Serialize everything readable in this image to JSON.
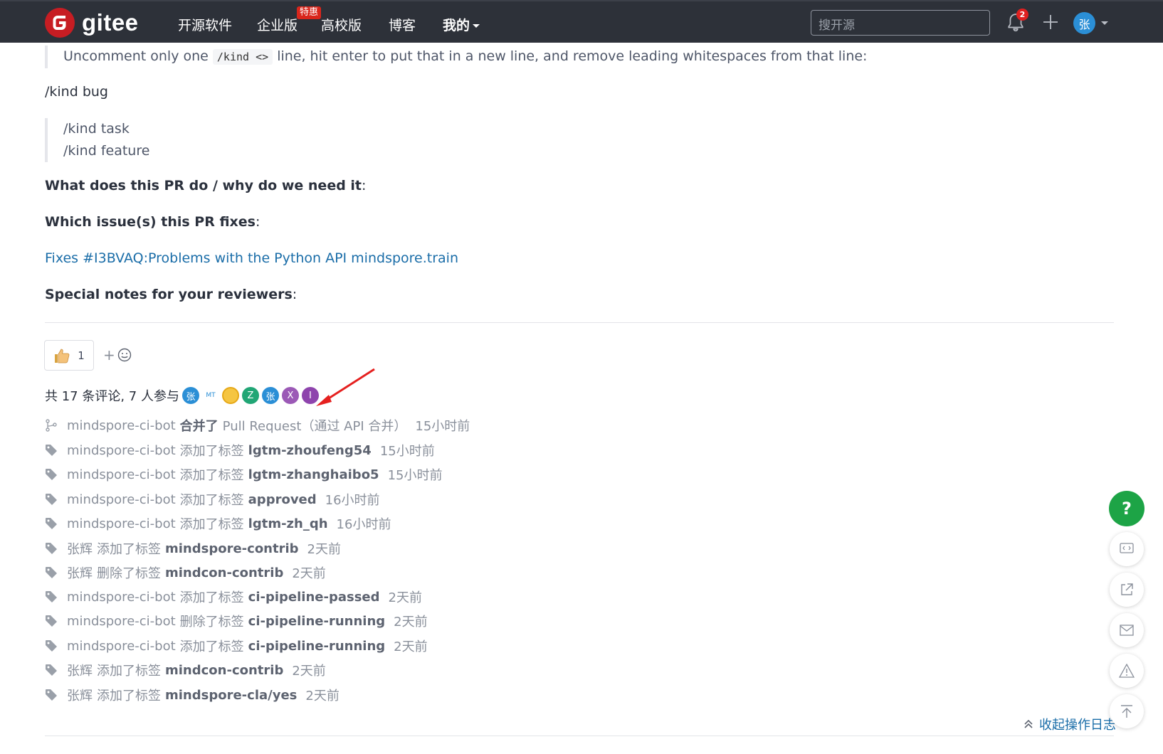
{
  "nav": {
    "brand": "gitee",
    "items": [
      "开源软件",
      "企业版",
      "高校版",
      "博客",
      "我的"
    ],
    "enterprise_badge": "特惠",
    "search_placeholder": "搜开源",
    "notification_count": "2",
    "avatar_initial": "张"
  },
  "description": {
    "instruction_pre": "Uncomment only one",
    "instruction_code": "/kind <>",
    "instruction_post": "line, hit enter to put that in a new line, and remove leading whitespaces from that line:",
    "kind_bug": "/kind bug",
    "kind_task": "/kind task",
    "kind_feature": "/kind feature",
    "what_heading": "What does this PR do / why do we need it",
    "which_heading": "Which issue(s) this PR fixes",
    "fixes_prefix": "Fixes",
    "fixes_link": "#I3BVAQ:Problems with the Python API mindspore.train",
    "notes_heading": "Special notes for your reviewers"
  },
  "reactions": {
    "thumbs_up_count": "1",
    "add_label": "+"
  },
  "participants": {
    "summary": "共 17 条评论, 7 人参与",
    "avatars": [
      {
        "text": "张",
        "color": "#2b8fd6"
      },
      {
        "text": "MT",
        "color": "#ffffff"
      },
      {
        "text": "",
        "color": "#f5c542"
      },
      {
        "text": "Z",
        "color": "#21a675"
      },
      {
        "text": "张",
        "color": "#2b8fd6"
      },
      {
        "text": "X",
        "color": "#9b59b6"
      },
      {
        "text": "I",
        "color": "#8e44ad"
      }
    ]
  },
  "activity": [
    {
      "icon": "merge",
      "user": "mindspore-ci-bot",
      "action": "合并了",
      "target": "Pull Request（通过 API 合并）",
      "time": "15小时前"
    },
    {
      "icon": "tag",
      "user": "mindspore-ci-bot",
      "action": "添加了标签",
      "target": "lgtm-zhoufeng54",
      "time": "15小时前"
    },
    {
      "icon": "tag",
      "user": "mindspore-ci-bot",
      "action": "添加了标签",
      "target": "lgtm-zhanghaibo5",
      "time": "15小时前"
    },
    {
      "icon": "tag",
      "user": "mindspore-ci-bot",
      "action": "添加了标签",
      "target": "approved",
      "time": "16小时前"
    },
    {
      "icon": "tag",
      "user": "mindspore-ci-bot",
      "action": "添加了标签",
      "target": "lgtm-zh_qh",
      "time": "16小时前"
    },
    {
      "icon": "tag",
      "user": "张辉",
      "action": "添加了标签",
      "target": "mindspore-contrib",
      "time": "2天前"
    },
    {
      "icon": "tag",
      "user": "张辉",
      "action": "删除了标签",
      "target": "mindcon-contrib",
      "time": "2天前"
    },
    {
      "icon": "tag",
      "user": "mindspore-ci-bot",
      "action": "添加了标签",
      "target": "ci-pipeline-passed",
      "time": "2天前"
    },
    {
      "icon": "tag",
      "user": "mindspore-ci-bot",
      "action": "删除了标签",
      "target": "ci-pipeline-running",
      "time": "2天前"
    },
    {
      "icon": "tag",
      "user": "mindspore-ci-bot",
      "action": "添加了标签",
      "target": "ci-pipeline-running",
      "time": "2天前"
    },
    {
      "icon": "tag",
      "user": "张辉",
      "action": "添加了标签",
      "target": "mindcon-contrib",
      "time": "2天前"
    },
    {
      "icon": "tag",
      "user": "张辉",
      "action": "添加了标签",
      "target": "mindspore-cla/yes",
      "time": "2天前"
    }
  ],
  "collapse_label": "收起操作日志",
  "fab": {
    "help_label": "?"
  }
}
